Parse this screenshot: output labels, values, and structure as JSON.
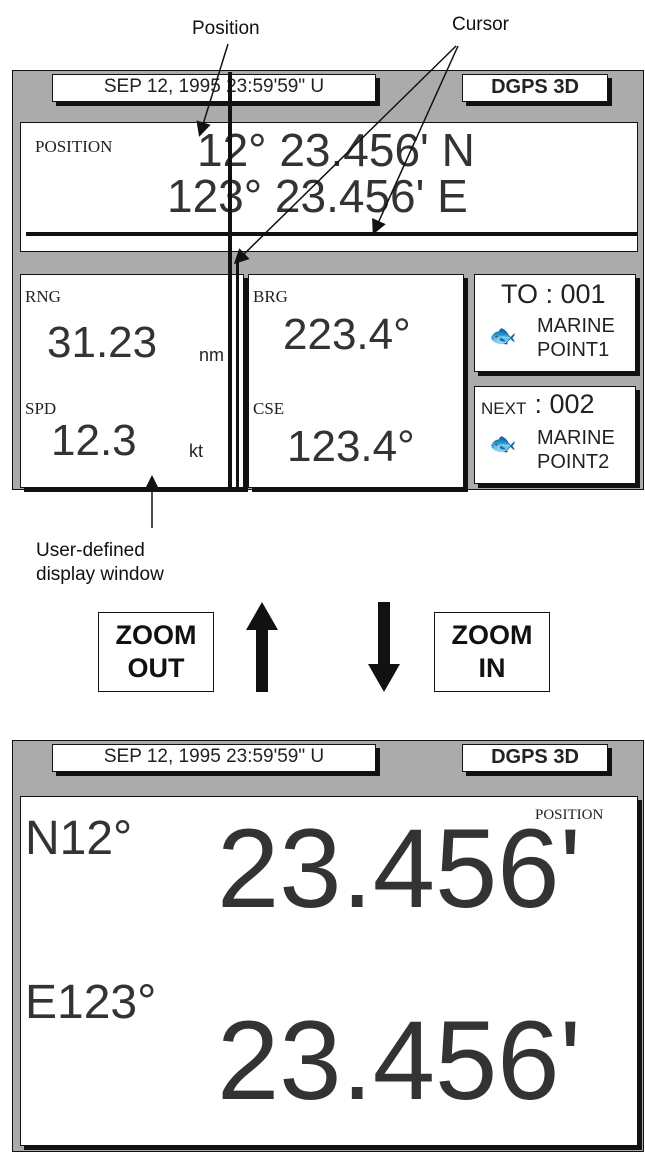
{
  "annotations": {
    "position": "Position",
    "cursor": "Cursor",
    "user_defined_line1": "User-defined",
    "user_defined_line2": "display window"
  },
  "top_screen": {
    "datetime": "SEP 12, 1995 23:59'59\" U",
    "status": "DGPS 3D",
    "position_label": "POSITION",
    "lat": "12° 23.456' N",
    "lon": "123° 23.456' E",
    "rng_label": "RNG",
    "rng_value": "31.23",
    "rng_unit": "nm",
    "spd_label": "SPD",
    "spd_value": "12.3",
    "spd_unit": "kt",
    "brg_label": "BRG",
    "brg_value": "223.4°",
    "cse_label": "CSE",
    "cse_value": "123.4°",
    "to_label": "TO : 001",
    "to_name1": "MARINE",
    "to_name2": "POINT1",
    "next_prefix": "NEXT",
    "next_suffix": " : 002",
    "next_name1": "MARINE",
    "next_name2": "POINT2",
    "waypoint_icon": "fish-icon"
  },
  "zoom": {
    "out_line1": "ZOOM",
    "out_line2": "OUT",
    "in_line1": "ZOOM",
    "in_line2": "IN",
    "up_arrow_icon": "arrow-up-icon",
    "down_arrow_icon": "arrow-down-icon"
  },
  "bottom_screen": {
    "datetime": "SEP 12, 1995 23:59'59\" U",
    "status": "DGPS 3D",
    "position_label": "POSITION",
    "lat_deg": "N12°",
    "lat_min": "23.456'",
    "lon_deg": "E123°",
    "lon_min": "23.456'"
  }
}
